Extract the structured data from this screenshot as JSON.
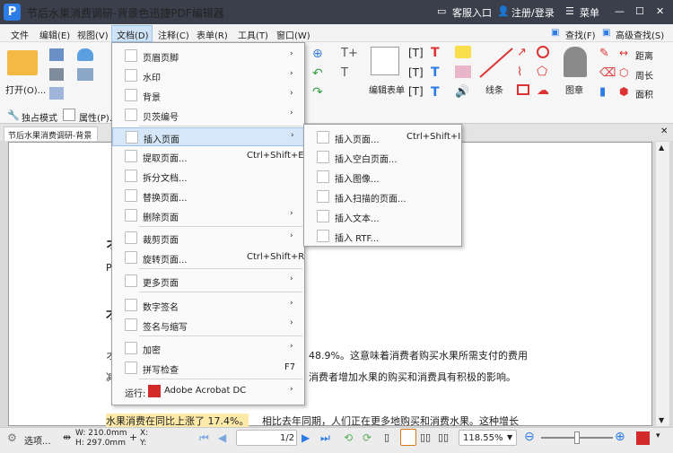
{
  "title": {
    "logo": "P",
    "text": "节后水果消费调研-背景色迅捷PDF编辑器",
    "support": "客服入口",
    "login": "注册/登录",
    "menu": "菜单"
  },
  "menubar": {
    "items": [
      "文件",
      "编辑(E)",
      "视图(V)",
      "文档(D)",
      "注释(C)",
      "表单(R)",
      "工具(T)",
      "窗口(W)"
    ],
    "find": "查找(F)",
    "adv_find": "高级查找(S)"
  },
  "ribbon": {
    "open": "打开(O)...",
    "edit_form": "编辑表单",
    "line": "线条",
    "stamp": "图章",
    "distance": "距离",
    "perimeter": "周长",
    "area": "面积",
    "solo_mode": "独占模式",
    "properties": "属性(P)..."
  },
  "tab": {
    "doc_name": "节后水果消费调研-背景色"
  },
  "doc": {
    "partial1": "P",
    "partial2": "才",
    "stat_line": "48.9%。这意味着消费者购买水果所需支付的费用",
    "influence": "消费者增加水果的购买和消费具有积极的影响。",
    "highlight": "水果消费在同比上涨了 17.4%。",
    "rest": "相比去年同期，人们正在更多地购买和消费水果。这种增长",
    "left_partial": "オ",
    "left_partial2": "减"
  },
  "doc_menu": {
    "items": [
      {
        "label": "页眉页脚",
        "arrow": "›"
      },
      {
        "label": "水印",
        "arrow": "›"
      },
      {
        "label": "背景",
        "arrow": "›"
      },
      {
        "label": "贝茨编号",
        "arrow": "›"
      },
      {
        "label": "插入页面",
        "arrow": "›"
      },
      {
        "label": "提取页面...",
        "shortcut": "Ctrl+Shift+E"
      },
      {
        "label": "拆分文档..."
      },
      {
        "label": "替换页面..."
      },
      {
        "label": "删除页面",
        "arrow": "›"
      },
      {
        "label": "裁剪页面",
        "arrow": "›"
      },
      {
        "label": "旋转页面...",
        "shortcut": "Ctrl+Shift+R"
      },
      {
        "label": "更多页面",
        "arrow": "›"
      },
      {
        "label": "数字签名",
        "arrow": "›"
      },
      {
        "label": "签名与缩写",
        "arrow": "›"
      },
      {
        "label": "加密",
        "arrow": "›"
      },
      {
        "label": "拼写检查",
        "shortcut": "F7"
      },
      {
        "label": "运行:",
        "app": "Adobe Acrobat DC",
        "arrow": "›"
      }
    ]
  },
  "insert_menu": {
    "items": [
      {
        "label": "插入页面...",
        "shortcut": "Ctrl+Shift+I"
      },
      {
        "label": "插入空白页面..."
      },
      {
        "label": "插入图像..."
      },
      {
        "label": "插入扫描的页面..."
      },
      {
        "label": "插入文本..."
      },
      {
        "label": "插入 RTF..."
      }
    ]
  },
  "status": {
    "options": "选项...",
    "width": "W: 210.0mm",
    "height": "H: 297.0mm",
    "x": "X:",
    "y": "Y:",
    "page": "1",
    "pages": "1/2",
    "zoom": "118.55%"
  },
  "colors": {
    "accent": "#2d7be5",
    "highlight": "#fde9a8",
    "menu_hover": "#d6e7f9"
  }
}
